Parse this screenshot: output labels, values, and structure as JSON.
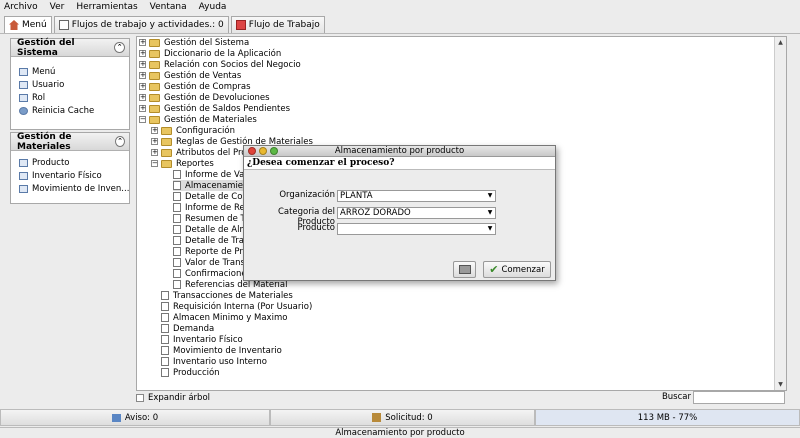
{
  "menubar": [
    "Archivo",
    "Ver",
    "Herramientas",
    "Ventana",
    "Ayuda"
  ],
  "tabs": [
    {
      "label": "Menú"
    },
    {
      "label": "Flujos de trabajo y actividades.: 0"
    },
    {
      "label": "Flujo de Trabajo"
    }
  ],
  "panels": {
    "sistema": {
      "title": "Gestión del Sistema",
      "items": [
        "Menú",
        "Usuario",
        "Rol",
        "Reinicia Cache"
      ]
    },
    "materiales": {
      "title": "Gestión de Materiales",
      "items": [
        "Producto",
        "Inventario Físico",
        "Movimiento de Inven..."
      ]
    }
  },
  "tree": [
    "Gestión del Sistema",
    "Diccionario de la Aplicación",
    "Relación con Socios del Negocio",
    "Gestión de Ventas",
    "Gestión de Compras",
    "Gestión de Devoluciones",
    "Gestión de Saldos Pendientes",
    "Gestión de Materiales",
    "Configuración",
    "Reglas de Gestión de Materiales",
    "Atributos del Producto",
    "Reportes",
    "Informe de Valo",
    "Almacenamiento",
    "Detalle de Conf",
    "Informe de Rea",
    "Resumen de Tr",
    "Detalle de Alma",
    "Detalle de Tran",
    "Reporte de Proc",
    "Valor de Transa",
    "Confirmaciones",
    "Referencias del Material",
    "Transacciones de Materiales",
    "Requisición Interna (Por Usuario)",
    "Almacen Minimo y Maximo",
    "Demanda",
    "Inventario Físico",
    "Movimiento de Inventario",
    "Inventario uso Interno",
    "Producción"
  ],
  "bottom": {
    "expand": "Expandir árbol",
    "search": "Buscar"
  },
  "status": {
    "aviso": "Aviso: 0",
    "solicitud": "Solicitud: 0",
    "memory": "113 MB - 77%",
    "footer": "Almacenamiento por producto"
  },
  "dialog": {
    "title": "Almacenamiento por producto",
    "question": "¿Desea comenzar el proceso?",
    "org_label": "Organización",
    "org_value": "PLANTA",
    "cat_label": "Categoria del Producto",
    "cat_value": "ARROZ DORADO",
    "prod_label": "Producto",
    "prod_value": "",
    "start": "Comenzar"
  },
  "colors": {
    "folder": "#e8c560",
    "close": "#e0443a",
    "min": "#e8b830",
    "max": "#5cb845"
  }
}
